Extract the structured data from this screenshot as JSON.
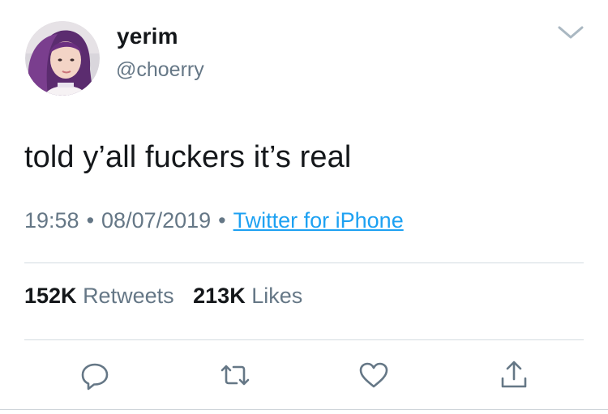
{
  "tweet": {
    "display_name": "yerim",
    "handle": "@choerry",
    "text": "told y’all fuckers it’s real",
    "time": "19:58",
    "date": "08/07/2019",
    "separator": "•",
    "source": "Twitter for iPhone"
  },
  "stats": {
    "retweets_count": "152K",
    "retweets_label": "Retweets",
    "likes_count": "213K",
    "likes_label": "Likes"
  },
  "icons": {
    "menu": "chevron-down-icon",
    "reply": "reply-icon",
    "retweet": "retweet-icon",
    "like": "heart-icon",
    "share": "share-icon"
  },
  "colors": {
    "text": "#14171a",
    "muted": "#657786",
    "link": "#1da1f2",
    "divider": "#d3dbe1"
  }
}
